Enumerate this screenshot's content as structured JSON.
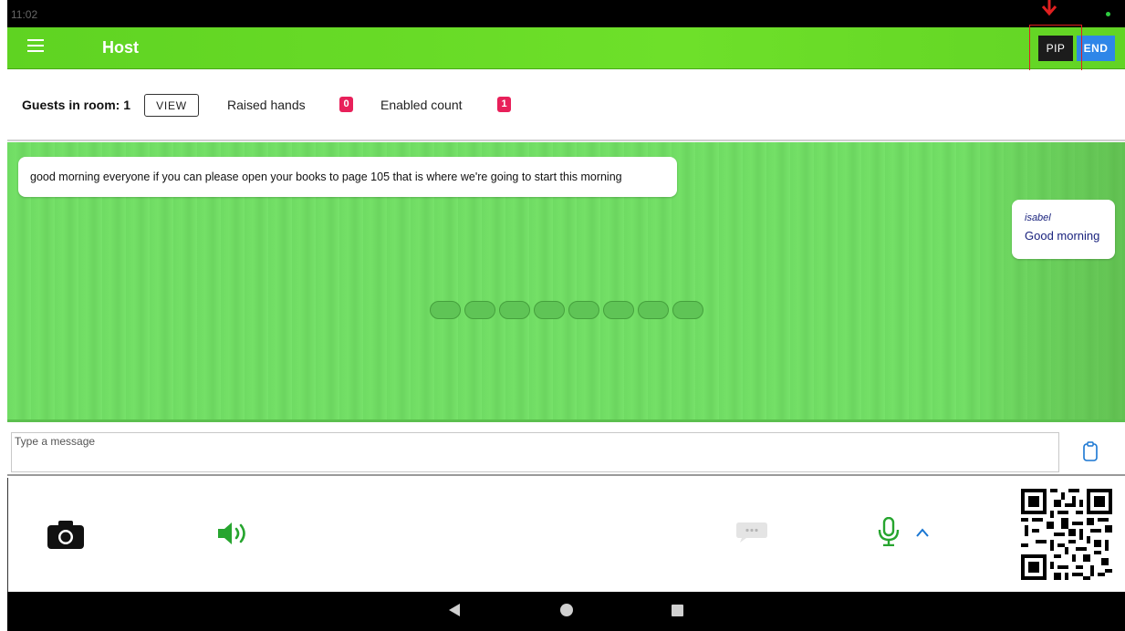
{
  "status_bar": {
    "time": "11:02"
  },
  "app_bar": {
    "title": "Host",
    "pip_label": "PIP",
    "end_label": "END",
    "accent_color": "#62d424"
  },
  "info_row": {
    "guests_label": "Guests in room: 1",
    "view_label": "VIEW",
    "raised_hands_label": "Raised hands",
    "raised_hands_count": "0",
    "enabled_count_label": "Enabled count",
    "enabled_count": "1",
    "badge_color": "#e8205a"
  },
  "video": {
    "caption": "good morning everyone if you can please open your books to page 105 that is where we're going to start this morning",
    "chat": {
      "name": "isabel",
      "text": "Good morning"
    },
    "background_color": "#74e067"
  },
  "message_input": {
    "placeholder": "Type a message",
    "value": ""
  },
  "toolbar": {
    "icons": [
      "camera-icon",
      "speaker-icon",
      "chat-icon",
      "microphone-icon",
      "chevron-up-icon",
      "qr-code"
    ]
  },
  "nav_bar": {
    "icons": [
      "back-icon",
      "home-icon",
      "recent-apps-icon"
    ]
  }
}
